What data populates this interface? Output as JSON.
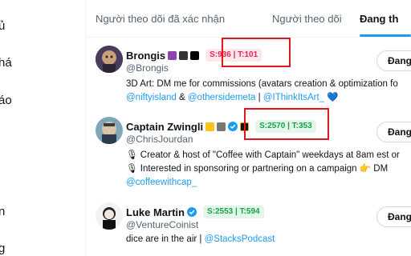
{
  "left_nav": {
    "items": [
      "ủ",
      "há",
      "áo",
      "n",
      "g"
    ]
  },
  "tabs": [
    {
      "label": "Người theo dõi đã xác nhận"
    },
    {
      "label": "Người theo dõi"
    },
    {
      "label": "Đang th"
    }
  ],
  "users": [
    {
      "name": "Brongis",
      "handle": "@Brongis",
      "stat": "S:936 | T:101",
      "stat_style": "red",
      "bio_lines": [
        [
          {
            "t": "3D Art: DM me for commissions (avatars creation & optimization fo",
            "link": false
          }
        ],
        [
          {
            "t": "@niftyisland",
            "link": true
          },
          {
            "t": " & ",
            "link": false
          },
          {
            "t": "@othersidemeta",
            "link": true
          },
          {
            "t": " | ",
            "link": false
          },
          {
            "t": "@IThinkItsArt_",
            "link": true
          },
          {
            "t": " 💙",
            "link": false
          }
        ]
      ],
      "button": "Đang"
    },
    {
      "name": "Captain Zwingli",
      "handle": "@ChrisJourdan",
      "stat": "S:2570 | T:353",
      "stat_style": "green",
      "bio_lines": [
        [
          {
            "t": "🎙 Creator & host of \"Coffee with Captain\" weekdays at 8am est or",
            "link": false
          }
        ],
        [
          {
            "t": "🎙 Interested in sponsoring or partnering on a campaign 👉 DM",
            "link": false
          }
        ],
        [
          {
            "t": "@coffeewithcap_",
            "link": true
          }
        ]
      ],
      "button": "Đang"
    },
    {
      "name": "Luke Martin",
      "handle": "@VentureCoinist",
      "stat": "S:2553 | T:594",
      "stat_style": "green",
      "bio_lines": [
        [
          {
            "t": "dice are in the air | ",
            "link": false
          },
          {
            "t": "@StacksPodcast",
            "link": true
          }
        ]
      ],
      "button": "Đang"
    }
  ],
  "colors": {
    "accent": "#1d9bf0",
    "highlight": "#e0161e",
    "stat_red": "#e0245e",
    "stat_green": "#17a34a"
  }
}
